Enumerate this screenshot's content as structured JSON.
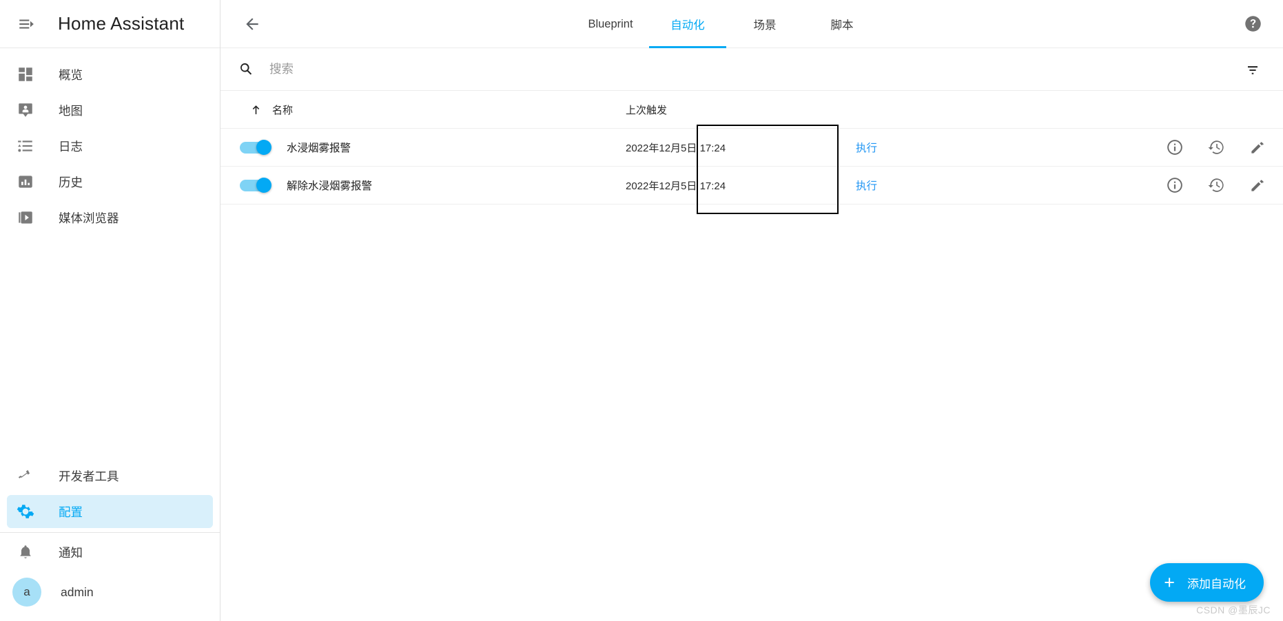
{
  "sidebar": {
    "menu_icon": "menu-open-icon",
    "title": "Home Assistant",
    "items": [
      {
        "label": "概览",
        "icon": "dashboard-icon",
        "active": false
      },
      {
        "label": "地图",
        "icon": "map-marker-account-icon",
        "active": false
      },
      {
        "label": "日志",
        "icon": "format-list-bulleted-icon",
        "active": false
      },
      {
        "label": "历史",
        "icon": "chart-box-icon",
        "active": false
      },
      {
        "label": "媒体浏览器",
        "icon": "play-box-multiple-icon",
        "active": false
      }
    ],
    "bottom_items": [
      {
        "label": "开发者工具",
        "icon": "hammer-icon",
        "active": false
      },
      {
        "label": "配置",
        "icon": "cog-icon",
        "active": true
      }
    ],
    "notifications": {
      "label": "通知",
      "icon": "bell-icon"
    },
    "user": {
      "label": "admin",
      "avatar_initial": "a",
      "avatar_color": "#a7e0f7"
    }
  },
  "toolbar": {
    "back_icon": "arrow-left-icon",
    "help_icon": "help-circle-icon",
    "tabs": [
      {
        "label": "Blueprint",
        "active": false
      },
      {
        "label": "自动化",
        "active": true
      },
      {
        "label": "场景",
        "active": false
      },
      {
        "label": "脚本",
        "active": false
      }
    ]
  },
  "search": {
    "icon": "search-icon",
    "placeholder": "搜索",
    "value": "",
    "filter_icon": "filter-variant-icon"
  },
  "table": {
    "columns": {
      "name": "名称",
      "last_triggered": "上次触发",
      "sort_icon": "arrow-up-icon"
    },
    "rows": [
      {
        "enabled": true,
        "name": "水浸烟雾报警",
        "last_triggered": "2022年12月5日 17:24",
        "execute_label": "执行",
        "actions": [
          "information-icon",
          "history-icon",
          "pencil-icon"
        ]
      },
      {
        "enabled": true,
        "name": "解除水浸烟雾报警",
        "last_triggered": "2022年12月5日 17:24",
        "execute_label": "执行",
        "actions": [
          "information-icon",
          "history-icon",
          "pencil-icon"
        ]
      }
    ]
  },
  "fab": {
    "icon": "plus-icon",
    "label": "添加自动化"
  },
  "watermark": "CSDN @墨辰JC",
  "colors": {
    "accent": "#03a9f4",
    "link": "#2196f3",
    "active_nav_bg": "#d9f0fb",
    "toggle_track": "#7fd3f5",
    "annotation_border": "#000000"
  }
}
